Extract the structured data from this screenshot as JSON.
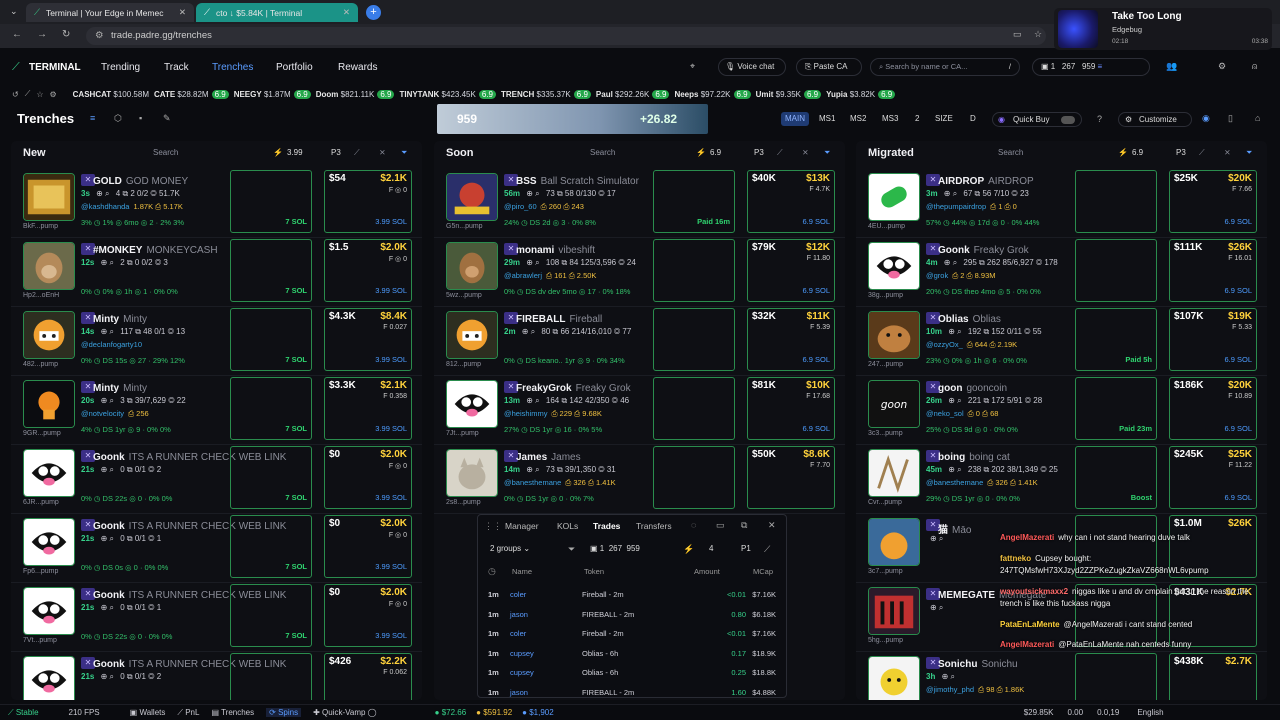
{
  "browser": {
    "tabs": [
      {
        "label": "Terminal | Your Edge in Memec"
      },
      {
        "label": "cto ↓ $5.84K | Terminal"
      }
    ],
    "url": "trade.padre.gg/trenches"
  },
  "media": {
    "title": "Take Too Long",
    "artist": "Edgebug",
    "elapsed": "02:18",
    "total": "03:38"
  },
  "nav": {
    "brand": "TERMINAL",
    "links": [
      "Trending",
      "Track",
      "Trenches",
      "Portfolio",
      "Rewards"
    ],
    "voice": "Voice chat",
    "paste": "Paste CA",
    "search": "Search by name or CA...",
    "counts": [
      "1",
      "267",
      "959"
    ]
  },
  "ticker": [
    {
      "name": "CASHCAT",
      "mc": "$100.58M"
    },
    {
      "name": "CATE",
      "mc": "$28.82M",
      "pill": "6.9"
    },
    {
      "name": "NEEGY",
      "mc": "$1.87M",
      "pill": "6.9"
    },
    {
      "name": "Doom",
      "mc": "$821.11K",
      "pill": "6.9"
    },
    {
      "name": "TINYTANK",
      "mc": "$423.45K",
      "pill": "6.9"
    },
    {
      "name": "TRENCH",
      "mc": "$335.37K",
      "pill": "6.9"
    },
    {
      "name": "Paul",
      "mc": "$292.26K",
      "pill": "6.9"
    },
    {
      "name": "Neeps",
      "mc": "$97.22K",
      "pill": "6.9"
    },
    {
      "name": "Umit",
      "mc": "$9.35K",
      "pill": "6.9"
    },
    {
      "name": "Yupia",
      "mc": "$3.82K",
      "pill": "6.9"
    }
  ],
  "header": {
    "title": "Trenches",
    "banner": {
      "left": "959",
      "right": "+26.82"
    },
    "presets": [
      "MAIN",
      "MS1",
      "MS2",
      "MS3",
      "2",
      "SIZE",
      "D"
    ],
    "quickbuy": "Quick Buy",
    "customize": "Customize"
  },
  "columns": [
    {
      "title": "New",
      "search": "Search",
      "amount": "3.99",
      "preset": "P3",
      "cards": [
        {
          "name": "GOLD",
          "sub": "GOD MONEY",
          "age": "3s",
          "stats": "4 ⧉ 2 0/2 ◎ 51.7K",
          "handle": "@kashdhanda",
          "followers": "1.87K ⎙ 5.17K",
          "bottom": "3% ◷ 1% ◎ 6mo  ◎ 2 · 2%  3%",
          "v": "$54",
          "mc": "$2.1K",
          "f": "F ◎ 0",
          "sol": "3.99 SOL",
          "qb": "7 SOL",
          "ca": "BkF...pump",
          "img": "gold"
        },
        {
          "name": "#MONKEY",
          "sub": "MONKEYCASH",
          "age": "12s",
          "stats": "2 ⧉ 0 0/2 ◎ 3",
          "handle": "",
          "followers": "",
          "bottom": "0% ◷ 0% ◎ 1h  ◎ 1 · 0%  0%",
          "v": "$1.5",
          "mc": "$2.0K",
          "f": "F ◎ 0",
          "sol": "3.99 SOL",
          "qb": "7 SOL",
          "ca": "Hp2...oEnH",
          "img": "monkey"
        },
        {
          "name": "Minty",
          "sub": "Minty",
          "age": "14s",
          "stats": "117 ⧉ 48 0/1 ◎ 13",
          "handle": "@declanfogarty10",
          "followers": "",
          "bottom": "0% ◷ DS 15s  ◎ 27 · 29%  12%",
          "v": "$4.3K",
          "mc": "$8.4K",
          "f": "F 0.027",
          "sol": "3.99 SOL",
          "qb": "7 SOL",
          "ca": "482...pump",
          "img": "minty"
        },
        {
          "name": "Minty",
          "sub": "Minty",
          "age": "20s",
          "stats": "3 ⧉ 39/7,629 ◎ 22",
          "handle": "@notvelocity",
          "followers": "⎙ 256",
          "bottom": "4% ◷ DS 1yr  ◎ 9 · 0%  0%",
          "v": "$3.3K",
          "mc": "$2.1K",
          "f": "F 0.358",
          "sol": "3.99 SOL",
          "qb": "7 SOL",
          "ca": "9GR...pump",
          "img": "minty2"
        },
        {
          "name": "Goonk",
          "sub": "ITS A RUNNER CHECK WEB LINK",
          "age": "21s",
          "stats": "0 ⧉ 0/1 ◎ 2",
          "handle": "",
          "followers": "",
          "bottom": "0% ◷ DS 22s  ◎ 0 · 0%  0%",
          "v": "$0",
          "mc": "$2.0K",
          "f": "F ◎ 0",
          "sol": "3.99 SOL",
          "qb": "7 SOL",
          "ca": "6JR...pump",
          "img": "goonk"
        },
        {
          "name": "Goonk",
          "sub": "ITS A RUNNER CHECK WEB LINK",
          "age": "21s",
          "stats": "0 ⧉ 0/1 ◎ 1",
          "handle": "",
          "followers": "",
          "bottom": "0% ◷ DS 0s  ◎ 0 · 0%  0%",
          "v": "$0",
          "mc": "$2.0K",
          "f": "F ◎ 0",
          "sol": "3.99 SOL",
          "qb": "7 SOL",
          "ca": "Fp6...pump",
          "img": "goonk"
        },
        {
          "name": "Goonk",
          "sub": "ITS A RUNNER CHECK WEB LINK",
          "age": "21s",
          "stats": "0 ⧉ 0/1 ◎ 1",
          "handle": "",
          "followers": "",
          "bottom": "0% ◷ DS 22s  ◎ 0 · 0%  0%",
          "v": "$0",
          "mc": "$2.0K",
          "f": "F ◎ 0",
          "sol": "3.99 SOL",
          "qb": "7 SOL",
          "ca": "7Vt...pump",
          "img": "goonk"
        },
        {
          "name": "Goonk",
          "sub": "ITS A RUNNER CHECK WEB LINK",
          "age": "21s",
          "stats": "0 ⧉ 0/1 ◎ 2",
          "handle": "",
          "followers": "",
          "bottom": "",
          "v": "$426",
          "mc": "$2.2K",
          "f": "F 0.062",
          "sol": "",
          "qb": "",
          "ca": "",
          "img": "goonk"
        }
      ]
    },
    {
      "title": "Soon",
      "search": "Search",
      "amount": "6.9",
      "preset": "P3",
      "cards": [
        {
          "name": "BSS",
          "sub": "Ball Scratch Simulator",
          "age": "56m",
          "stats": "73 ⧉ 58 0/130 ◎ 17",
          "handle": "@piro_60",
          "followers": "⎙ 260 ⎙ 243",
          "bottom": "24% ◷ DS 2d  ◎ 3 · 0%  8%",
          "v": "$40K",
          "mc": "$13K",
          "f": "F 4.7K",
          "sol": "6.9 SOL",
          "qb": "Paid 16m",
          "ca": "G5n...pump",
          "img": "bss"
        },
        {
          "name": "monami",
          "sub": "vibeshift",
          "age": "29m",
          "stats": "108 ⧉ 84 125/3,596 ◎ 24",
          "handle": "@abrawlerj",
          "followers": "⎙ 161 ⎙ 2.50K",
          "bottom": "0% ◷ DS dv dev 5mo  ◎ 17 · 0%  18%",
          "v": "$79K",
          "mc": "$12K",
          "f": "F 11.80",
          "sol": "6.9 SOL",
          "qb": "",
          "ca": "5wz...pump",
          "img": "monami"
        },
        {
          "name": "FIREBALL",
          "sub": "Fireball",
          "age": "2m",
          "stats": "80 ⧉ 66 214/16,010 ◎ 77",
          "handle": "",
          "followers": "",
          "bottom": "0% ◷ DS keano.. 1yr  ◎ 9 · 0%  34%",
          "v": "$32K",
          "mc": "$11K",
          "f": "F 5.39",
          "sol": "6.9 SOL",
          "qb": "",
          "ca": "812...pump",
          "img": "minty"
        },
        {
          "name": "FreakyGrok",
          "sub": "Freaky Grok",
          "age": "13m",
          "stats": "164 ⧉ 142 42/350 ◎ 46",
          "handle": "@heishimmy",
          "followers": "⎙ 229 ⎙ 9.68K",
          "bottom": "27% ◷ DS 1yr  ◎ 16 · 0%  5%",
          "v": "$81K",
          "mc": "$10K",
          "f": "F 17.68",
          "sol": "6.9 SOL",
          "qb": "",
          "ca": "7Jt...pump",
          "img": "goonk"
        },
        {
          "name": "James",
          "sub": "James",
          "age": "14m",
          "stats": "73 ⧉ 39/1,350 ◎ 31",
          "handle": "@banesthemane",
          "followers": "⎙ 326 ⎙ 1.41K",
          "bottom": "0% ◷ DS 1yr  ◎ 0 · 0%  7%",
          "v": "$50K",
          "mc": "$8.6K",
          "f": "F 7.70",
          "sol": "",
          "qb": "",
          "ca": "2s8...pump",
          "img": "cat"
        }
      ]
    },
    {
      "title": "Migrated",
      "search": "Search",
      "amount": "6.9",
      "preset": "P3",
      "cards": [
        {
          "name": "AIRDROP",
          "sub": "AIRDROP",
          "age": "3m",
          "stats": "67 ⧉ 56 7/10 ◎ 23",
          "handle": "@thepumpairdrop",
          "followers": "⎙ 1 ⎙ 0",
          "bottom": "57% ◷ 44% ◎ 17d  ◎ 0 · 0%  44%",
          "v": "$25K",
          "mc": "$20K",
          "f": "F 7.66",
          "sol": "6.9 SOL",
          "qb": "",
          "ca": "4EU...pump",
          "img": "pill"
        },
        {
          "name": "Goonk",
          "sub": "Freaky Grok",
          "age": "4m",
          "stats": "295 ⧉ 262 85/6,927 ◎ 178",
          "handle": "@grok",
          "followers": "⎙ 2 ⎙ 8.93M",
          "bottom": "20% ◷ DS theo 4mo  ◎ 5 · 0%  0%",
          "v": "$111K",
          "mc": "$26K",
          "f": "F 16.01",
          "sol": "6.9 SOL",
          "qb": "",
          "ca": "38g...pump",
          "img": "goonk"
        },
        {
          "name": "Oblias",
          "sub": "Oblias",
          "age": "10m",
          "stats": "192 ⧉ 152 0/11 ◎ 55",
          "handle": "@ozzyOx_",
          "followers": "⎙ 644 ⎙ 2.19K",
          "bottom": "23% ◷ 0% ◎ 1h  ◎ 6 · 0%  0%",
          "v": "$107K",
          "mc": "$19K",
          "f": "F 5.33",
          "sol": "6.9 SOL",
          "qb": "Paid 5h",
          "ca": "247...pump",
          "img": "hamster"
        },
        {
          "name": "goon",
          "sub": "gooncoin",
          "age": "26m",
          "stats": "221 ⧉ 172 5/91 ◎ 28",
          "handle": "@neko_sol",
          "followers": "⎙ 0 ⎙ 68",
          "bottom": "25% ◷ DS 9d  ◎ 0 · 0%  0%",
          "v": "$186K",
          "mc": "$20K",
          "f": "F 10.89",
          "sol": "6.9 SOL",
          "qb": "Paid 23m",
          "ca": "3c3...pump",
          "img": "goon"
        },
        {
          "name": "boing",
          "sub": "boing cat",
          "age": "45m",
          "stats": "238 ⧉ 202 38/1,349 ◎ 25",
          "handle": "@banesthemane",
          "followers": "⎙ 326 ⎙ 1.41K",
          "bottom": "29% ◷ DS 1yr  ◎ 0 · 0%  0%",
          "v": "$245K",
          "mc": "$25K",
          "f": "F 11.22",
          "sol": "6.9 SOL",
          "qb": "Boost",
          "ca": "Cvr...pump",
          "img": "boing"
        },
        {
          "name": "猫",
          "sub": "Māo",
          "age": "",
          "stats": "",
          "handle": "",
          "followers": "",
          "bottom": "",
          "v": "$1.0M",
          "mc": "$26K",
          "f": "",
          "sol": "",
          "qb": "",
          "ca": "3c7...pump",
          "img": "maocat"
        },
        {
          "name": "MEMEGATE",
          "sub": "Memegate",
          "age": "",
          "stats": "",
          "handle": "",
          "followers": "",
          "bottom": "",
          "v": "$431K",
          "mc": "$2.7K",
          "f": "",
          "sol": "",
          "qb": "",
          "ca": "5hg...pump",
          "img": "memegate"
        },
        {
          "name": "Sonichu",
          "sub": "Sonichu",
          "age": "3h",
          "stats": "",
          "handle": "@jimothy_phd",
          "followers": "⎙ 98 ⎙ 1.86K",
          "bottom": "",
          "v": "$438K",
          "mc": "$2.7K",
          "f": "",
          "sol": "",
          "qb": "",
          "ca": "",
          "img": "sonichu"
        }
      ]
    }
  ],
  "manager": {
    "tabs": [
      "Manager",
      "KOLs",
      "Trades",
      "Transfers"
    ],
    "groups": "2 groups",
    "counts": [
      "1",
      "267",
      "959"
    ],
    "amount": "4",
    "preset": "P1",
    "headers": [
      "Name",
      "Token",
      "Amount",
      "MCap"
    ],
    "rows": [
      [
        "1m",
        "coler",
        "Fireball - 2m",
        "<0.01",
        "$7.16K"
      ],
      [
        "1m",
        "jason",
        "FIREBALL - 2m",
        "0.80",
        "$6.18K"
      ],
      [
        "1m",
        "coler",
        "Fireball - 2m",
        "<0.01",
        "$7.16K"
      ],
      [
        "1m",
        "cupsey",
        "Oblias - 6h",
        "0.17",
        "$18.9K"
      ],
      [
        "1m",
        "cupsey",
        "Oblias - 6h",
        "0.25",
        "$18.8K"
      ],
      [
        "1m",
        "jason",
        "FIREBALL - 2m",
        "1.60",
        "$4.88K"
      ]
    ]
  },
  "chat": [
    {
      "user": "AngelMazerati",
      "msg": "why can i not stand hearing duve talk",
      "color": "#ff5a5a"
    },
    {
      "user": "fattneko",
      "msg": "Cupsey bought: 247TQMsfwH73XJzyd2ZZPKeZugkZkaVZ668nWL6vpump",
      "color": "#f0c040"
    },
    {
      "user": "wayoutsickmaxx2",
      "msg": "niggas like u and dv cmplain but ur the reason the trench is like this fuckass nigga",
      "color": "#ff6b6b"
    },
    {
      "user": "PataEnLaMente",
      "msg": "@AngelMazerati i cant stand cented",
      "color": "#ffd23c"
    },
    {
      "user": "AngelMazerati",
      "msg": "@PataEnLaMente nah centeds funny",
      "color": "#ff5a5a"
    }
  ],
  "status": {
    "stable": "Stable",
    "fps": "210 FPS",
    "items": [
      "Wallets",
      "PnL",
      "Trenches",
      "Spins",
      "Quick-Vamp"
    ],
    "prices": [
      "$72.66",
      "$591.92",
      "$1,902"
    ],
    "right": [
      "$29.85K",
      "0.00",
      "0.0,19",
      "English"
    ]
  }
}
